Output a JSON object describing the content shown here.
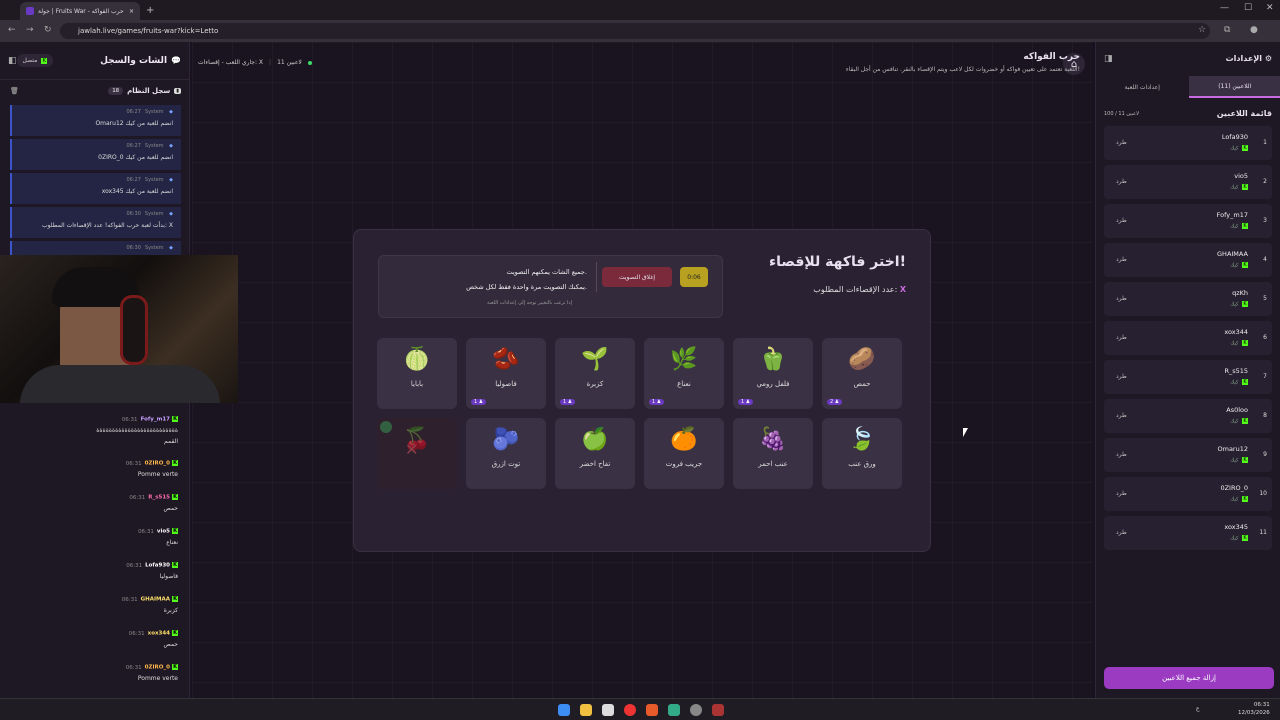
{
  "browser": {
    "tab_title": "جولة | Fruits War - حرب الفواكه",
    "new_tab": "+",
    "url": "jawlah.live/games/fruits-war?kick=Letto"
  },
  "chat": {
    "title": "الشات والسجل",
    "online_label": "متصل",
    "system_log_label": "سجل النظام",
    "system_log_count": "18",
    "system_messages": [
      {
        "sender": "System",
        "time": "06:27",
        "text": "Omaru12 انضم للعبة من كيك"
      },
      {
        "sender": "System",
        "time": "06:27",
        "text": "0ZIRO_0 انضم للعبة من كيك"
      },
      {
        "sender": "System",
        "time": "06:27",
        "text": "xox345 انضم للعبة من كيك"
      },
      {
        "sender": "System",
        "time": "06:30",
        "text": "بدأت لعبة حرب الفواكه! عدد الإقصاءات المطلوب: X"
      },
      {
        "sender": "System",
        "time": "06:30",
        "text": ""
      }
    ],
    "messages": [
      {
        "user": "Fofy_m17",
        "time": "06:31",
        "text": "ةةةةةةةةةةةةةةةةةةةةةةةةةة",
        "extra": "القمم",
        "color": "#c8a0ff"
      },
      {
        "user": "0ZIRO_0",
        "time": "06:31",
        "text": "Pomme verte",
        "color": "#ffb84a"
      },
      {
        "user": "R_s515",
        "time": "06:31",
        "text": "حمص",
        "color": "#ff6fb0"
      },
      {
        "user": "vio5",
        "time": "06:31",
        "text": "نعناع",
        "color": "#ffffff"
      },
      {
        "user": "Lofa930",
        "time": "06:31",
        "text": "فاصوليا",
        "color": "#ffffff"
      },
      {
        "user": "GHAIMAA",
        "time": "06:31",
        "text": "كزبرة",
        "color": "#ffe06a"
      },
      {
        "user": "xox344",
        "time": "06:31",
        "text": "حمص",
        "color": "#ffe06a"
      },
      {
        "user": "0ZIRO_0",
        "time": "06:31",
        "text": "Pomme verte",
        "color": "#ffb84a"
      }
    ]
  },
  "header": {
    "title": "حرب الفواكه",
    "subtitle": "اللعبة تعتمد على تعيين فواكه أو خضروات لكل لاعب ويتم الإقصاء بالنقر. تنافس من أجل البقاء!",
    "players_count": "11 لاعبين",
    "status": "جاري اللعب - إقصاءات: X"
  },
  "card": {
    "title": "اختر فاكهة للإقصاء!",
    "eliminations_label": "عدد الإقصاءات المطلوب:",
    "eliminations_value": "X",
    "timer": "0:06",
    "close_vote": "إغلاق التصويت",
    "vote_line1": "جميع الشات يمكنهم التصويت.",
    "vote_line2": "يمكنك التصويت مرة واحدة فقط لكل شخص.",
    "vote_line3": "إذا ترغب بالتغيير توجه إلى إعدادات اللعبة"
  },
  "fruits": [
    {
      "name": "حمص",
      "icon": "🥔",
      "votes": "2"
    },
    {
      "name": "فلفل رومي",
      "icon": "🫑",
      "votes": "1"
    },
    {
      "name": "نعناع",
      "icon": "🌿",
      "votes": "1"
    },
    {
      "name": "كزبرة",
      "icon": "🌱",
      "votes": "1"
    },
    {
      "name": "فاصوليا",
      "icon": "🫘",
      "votes": "1"
    },
    {
      "name": "بابايا",
      "icon": "🍈",
      "votes": ""
    },
    {
      "name": "ورق عنب",
      "icon": "🍃",
      "votes": ""
    },
    {
      "name": "عنب احمر",
      "icon": "🍇",
      "votes": ""
    },
    {
      "name": "جريب فروت",
      "icon": "🍊",
      "votes": ""
    },
    {
      "name": "تفاح اخضر",
      "icon": "🍏",
      "votes": ""
    },
    {
      "name": "توت ازرق",
      "icon": "🫐",
      "votes": ""
    },
    {
      "name": "",
      "icon": "🍒",
      "votes": "",
      "eliminated": "eliminated"
    }
  ],
  "settings": {
    "title": "الإعدادات",
    "tab_players": "اللاعبين (11)",
    "tab_game": "إعدادات اللعبة",
    "list_title": "قائمة اللاعبين",
    "capacity": "100 / 11 لاعبين",
    "kick_label": "طرد",
    "platform_tag": "كيك",
    "players": [
      "Lofa930",
      "vio5",
      "Fofy_m17",
      "GHAIMAA",
      "qzKh",
      "xox344",
      "R_s515",
      "As0loo",
      "Omaru12",
      "0ZIRO_0",
      "xox345"
    ],
    "remove_all": "إزالة جميع اللاعبين"
  },
  "taskbar": {
    "time": "06:31",
    "date": "12/03/2026",
    "lang": "ع"
  }
}
